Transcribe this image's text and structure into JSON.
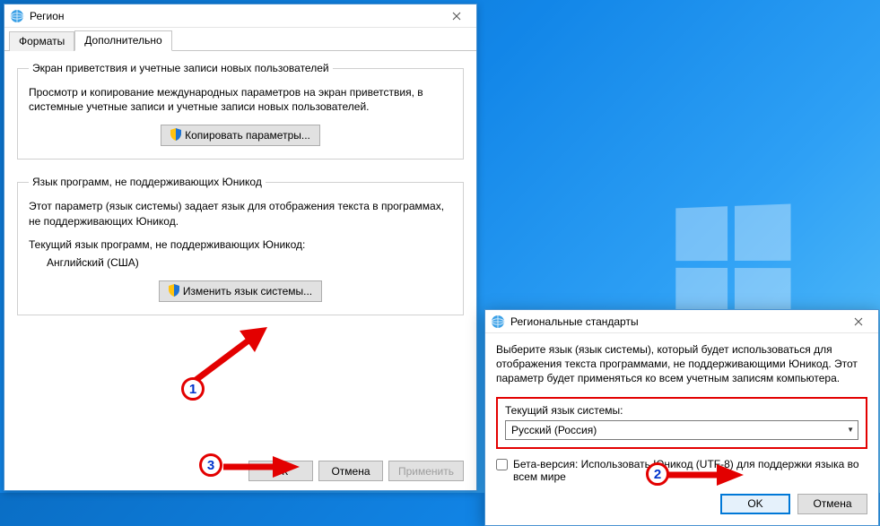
{
  "region": {
    "title": "Регион",
    "tabs": {
      "formats": "Форматы",
      "additional": "Дополнительно"
    },
    "welcome": {
      "legend": "Экран приветствия и учетные записи новых пользователей",
      "desc": "Просмотр и копирование международных параметров на экран приветствия, в системные учетные записи и учетные записи новых пользователей.",
      "copy_button": "Копировать параметры..."
    },
    "nonunicode": {
      "legend": "Язык программ, не поддерживающих Юникод",
      "desc": "Этот параметр (язык системы) задает язык для отображения текста в программах, не поддерживающих Юникод.",
      "current_label": "Текущий язык программ, не поддерживающих Юникод:",
      "current_value": "Английский (США)",
      "change_button": "Изменить язык системы..."
    },
    "buttons": {
      "ok": "ОК",
      "cancel": "Отмена",
      "apply": "Применить"
    }
  },
  "locale": {
    "title": "Региональные стандарты",
    "desc": "Выберите язык (язык системы), который будет использоваться для отображения текста программами, не поддерживающими Юникод. Этот параметр будет применяться ко всем учетным записям компьютера.",
    "field_label": "Текущий язык системы:",
    "selected": "Русский (Россия)",
    "beta_label": "Бета-версия: Использовать Юникод (UTF-8) для поддержки языка во всем мире",
    "ok": "OK",
    "cancel": "Отмена"
  },
  "annotations": {
    "n1": "1",
    "n2": "2",
    "n3": "3"
  }
}
